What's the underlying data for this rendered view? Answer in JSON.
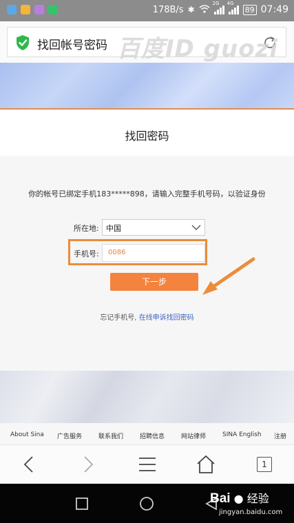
{
  "status_bar": {
    "network_speed": "178B/s",
    "net_2g": "2G",
    "net_4g": "4G",
    "battery": "89",
    "time": "07:49"
  },
  "address_bar": {
    "title": "找回帐号密码",
    "watermark": "百度ID guozi"
  },
  "page": {
    "title": "找回密码",
    "info": "你的帐号已绑定手机183*****898，请输入完整手机号码，以验证身份",
    "location_label": "所在地:",
    "location_value": "中国",
    "phone_label": "手机号:",
    "phone_value": "0086",
    "next_button": "下一步",
    "forgot_text": "忘记手机号,",
    "forgot_link": "在线申诉找回密码"
  },
  "footer": {
    "links": [
      "About Sina",
      "广告服务",
      "联系我们",
      "招聘信息",
      "网站律师",
      "SINA English",
      "注册"
    ]
  },
  "browser_nav": {
    "tab_count": "1"
  },
  "baidu": {
    "logo": "Bai",
    "text": "经验",
    "url": "jingyan.baidu.com"
  },
  "colors": {
    "accent_orange": "#f4833e",
    "highlight_border": "#e98c3a",
    "link_blue": "#3b63c4",
    "shield_green": "#2eb84b"
  }
}
